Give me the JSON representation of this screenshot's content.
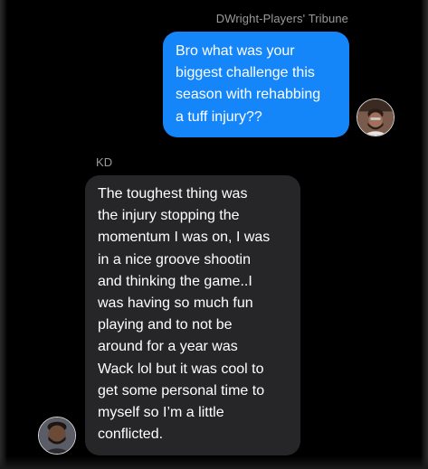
{
  "thread": {
    "messages": [
      {
        "direction": "outgoing",
        "sender": "DWright-Players' Tribune",
        "text": "Bro what was your\nbiggest challenge this\nseason with rehabbing\na tuff injury??",
        "avatar_icon": "user-avatar-icon"
      },
      {
        "direction": "incoming",
        "sender": "KD",
        "text": "The toughest thing was\nthe injury stopping the\nmomentum I was on, I was\nin a nice groove shootin\nand thinking the game..I\nwas having so much fun\nplaying and to not be\naround for a year was\nWack lol but it was cool to\nget some personal time to\nmyself so I’m a little\nconflicted.",
        "avatar_icon": "user-avatar-icon"
      }
    ]
  },
  "colors": {
    "background": "#000000",
    "outgoing_bubble": "#1586fa",
    "incoming_bubble": "#262628",
    "sender_name": "#9a9a9a"
  }
}
